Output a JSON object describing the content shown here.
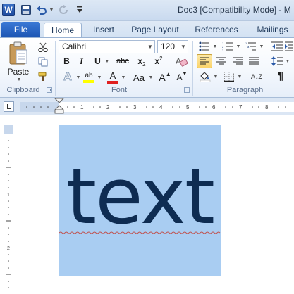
{
  "titlebar": {
    "app_icon": "W",
    "title": "Doc3 [Compatibility Mode] - M"
  },
  "tabs": {
    "file": "File",
    "items": [
      "Home",
      "Insert",
      "Page Layout",
      "References",
      "Mailings"
    ],
    "active": "Home"
  },
  "clipboard": {
    "paste_label": "Paste",
    "group_label": "Clipboard"
  },
  "font": {
    "font_name": "Calibri",
    "font_size": "120",
    "bold": "B",
    "italic": "I",
    "underline": "U",
    "strikethrough": "abc",
    "subscript": "x",
    "superscript": "x",
    "clear_format": "A",
    "highlight": "ab",
    "font_color": "A",
    "change_case": "Aa",
    "grow_font": "A",
    "shrink_font": "A",
    "group_label": "Font"
  },
  "paragraph": {
    "sort": "A↓Z",
    "pilcrow": "¶",
    "group_label": "Paragraph"
  },
  "document": {
    "text": "text"
  },
  "colors": {
    "highlight_bar": "#ffff00",
    "font_color_bar": "#e02020",
    "selection": "#a9cdf2",
    "text": "#0e2c52"
  }
}
